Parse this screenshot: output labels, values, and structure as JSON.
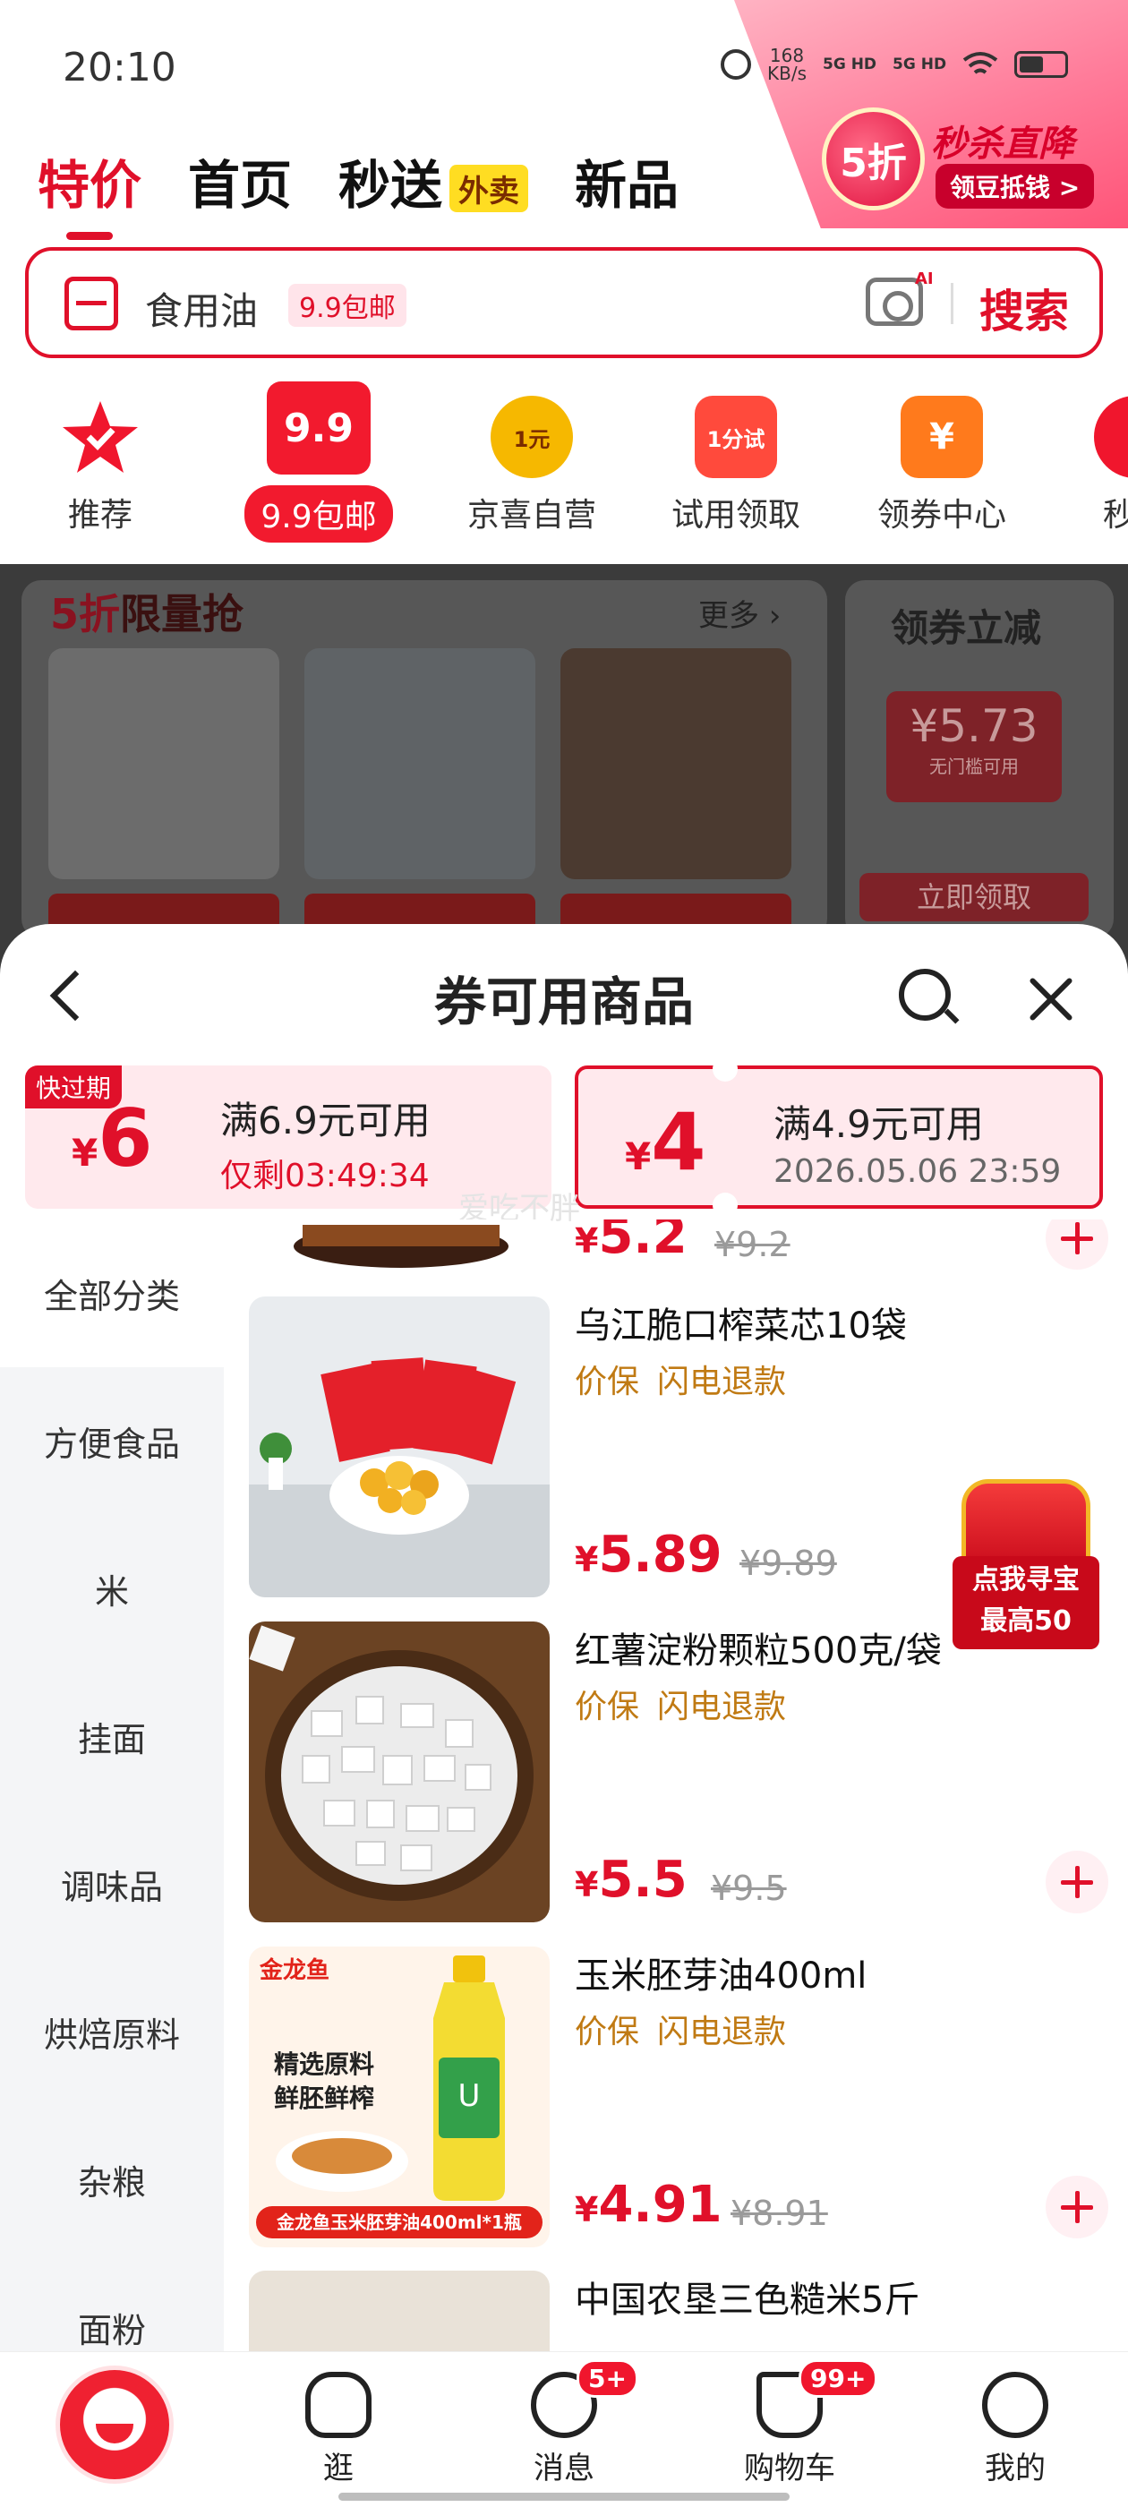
{
  "status_bar": {
    "time": "20:10",
    "net_speed_value": "168",
    "net_speed_unit": "KB/s",
    "sim1": "5G HD",
    "sim2": "5G HD"
  },
  "promo_banner": {
    "badge": "5折",
    "title": "秒杀直降",
    "subtitle": "领豆抵钱 >"
  },
  "top_nav": {
    "tabs": [
      "特价",
      "首页",
      "秒送",
      "新品"
    ],
    "badge": "外卖",
    "active_index": 0
  },
  "search": {
    "text": "食用油",
    "tag": "9.9包邮",
    "ai": "AI",
    "button": "搜索"
  },
  "categories": [
    {
      "label": "推荐",
      "icon": "star-icon",
      "icon_text": "",
      "color": "#f0162d"
    },
    {
      "label": "9.9包邮",
      "icon": "price-tag-icon",
      "icon_text": "9.9",
      "color": "#f21a2e",
      "active": true
    },
    {
      "label": "京喜自营",
      "icon": "yuan-badge-icon",
      "icon_text": "1元",
      "color": "#f6b800"
    },
    {
      "label": "试用领取",
      "icon": "gift-bag-icon",
      "icon_text": "1分试",
      "color": "#ff4a3c"
    },
    {
      "label": "领券中心",
      "icon": "coupon-icon",
      "icon_text": "¥",
      "color": "#ff7a1c"
    },
    {
      "label": "秒",
      "icon": "more-icon",
      "icon_text": "",
      "color": "#f0162d"
    }
  ],
  "background_section": {
    "flash_title_accent": "5折",
    "flash_title": "限量抢",
    "more": "更多 ›",
    "coupon_side_title": "领券立减",
    "coupon_side_amount": "¥5.73",
    "coupon_side_sub": "无门槛可用",
    "coupon_side_button": "立即领取"
  },
  "sheet": {
    "title": "券可用商品",
    "watermark": "爱吃不胖",
    "coupons": [
      {
        "tag": "快过期",
        "currency": "¥",
        "amount": "6",
        "condition": "满6.9元可用",
        "sub": "仅剩03:49:34"
      },
      {
        "tag": "",
        "currency": "¥",
        "amount": "4",
        "condition": "满4.9元可用",
        "sub": "2026.05.06 23:59"
      }
    ],
    "side_categories": [
      "全部分类",
      "方便食品",
      "米",
      "挂面",
      "调味品",
      "烘焙原料",
      "杂粮",
      "面粉"
    ],
    "products": [
      {
        "name": "",
        "tags": [],
        "currency": "¥",
        "price": "5.2",
        "old_price": "¥9.2",
        "image": "spicy-strips"
      },
      {
        "name": "乌江脆口榨菜芯10袋",
        "tags": [
          "价保",
          "闪电退款"
        ],
        "currency": "¥",
        "price": "5.89",
        "old_price": "¥9.89",
        "image": "pickles"
      },
      {
        "name": "红薯淀粉颗粒500克/袋",
        "tags": [
          "价保",
          "闪电退款"
        ],
        "currency": "¥",
        "price": "5.5",
        "old_price": "¥9.5",
        "image": "starch"
      },
      {
        "name": "玉米胚芽油400ml",
        "tags": [
          "价保",
          "闪电退款"
        ],
        "currency": "¥",
        "price": "4.91",
        "old_price": "¥8.91",
        "image": "corn-oil"
      },
      {
        "name": "中国农垦三色糙米5斤",
        "tags": [],
        "currency": "¥",
        "price": "",
        "old_price": "",
        "image": "rice"
      }
    ],
    "oil_ad": {
      "brand": "金龙鱼",
      "line1": "精选原料",
      "line2": "鲜胚鲜榨",
      "banner": "金龙鱼玉米胚芽油400ml*1瓶"
    },
    "treasure": {
      "line1": "点我寻宝",
      "line2": "最高50"
    }
  },
  "tab_bar": {
    "tabs": [
      {
        "label": "",
        "icon": "jd-mascot-icon"
      },
      {
        "label": "逛",
        "icon": "stroll-icon"
      },
      {
        "label": "消息",
        "icon": "message-icon",
        "badge": "5+"
      },
      {
        "label": "购物车",
        "icon": "cart-icon",
        "badge": "99+"
      },
      {
        "label": "我的",
        "icon": "profile-icon"
      }
    ]
  }
}
